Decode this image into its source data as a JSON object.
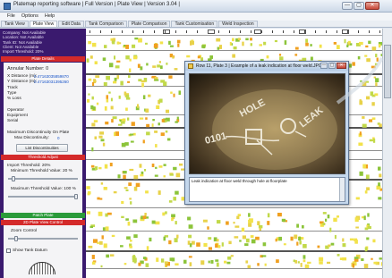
{
  "window": {
    "title": "Platemap reporting software | Full Version | Plate View | Version 3.04 |",
    "controls": [
      "—",
      "▢",
      "✕"
    ]
  },
  "menu": [
    "File",
    "Options",
    "Help"
  ],
  "tabs": [
    "Tank View",
    "Plate View",
    "Edit Data",
    "Tank Comparison",
    "Plate Comparison",
    "Tank Customisation",
    "Weld Inspection"
  ],
  "active_tab": "Plate View",
  "status": [
    "Company: Not Available",
    "Location: Not Available",
    "Tank ID: Not Available",
    "Client: Not Available",
    "Import Threshold: 20%"
  ],
  "plate_details": {
    "header": "Plate Details",
    "annular_number": "Annular Number: 0",
    "x_distance_label": "X Distance (m):",
    "x_distance_value": "0.47163035859870",
    "y_distance_label": "Y Distance (m):",
    "y_distance_value": "0.47163031395260",
    "tracks": "Track",
    "type": "Type",
    "loss": "% Loss",
    "operator": "Operator",
    "equipment": "Equipment",
    "serial": "Serial",
    "max_discontinuity_label": "Maximum Discontinuity On Plate",
    "max_discontinuity_sub": "Max Discontinuity:",
    "max_discontinuity_value": "0",
    "list_button": "List Discontinuities"
  },
  "threshold": {
    "header": "Threshold Adjust",
    "import_threshold": "Import Threshold: 20%",
    "min_label": "Minimum Threshold Value: 20 %",
    "min_value": 0.05,
    "max_label": "Maximum Threshold Value: 100 %",
    "max_value": 1.0
  },
  "patch_plate_button": "Patch Plate",
  "view_control": {
    "header": "2D Plate View Control",
    "zoom_label": "Zoom Control",
    "zoom_value": 0.1,
    "show_tank_datum": "Show Tank Datum"
  },
  "popup": {
    "title": "Row 11, Plate 3 | Example of a leak indication at floor weld.JPG",
    "caption": "Leak indication at floor weld through hole at floorplate",
    "photo_text": [
      "HOLE",
      "LEAK",
      "0101"
    ]
  },
  "colors": {
    "sidebar": "#3a1a6e",
    "red_header": "#d42a2a",
    "green_header": "#2a9b3a",
    "spot_yellow": "#f2e24a",
    "spot_orange": "#f0a020",
    "spot_green": "#8cc43a"
  },
  "icons": {
    "app": "app-icon",
    "popup": "image-icon",
    "close": "close-icon",
    "minimize": "minimize-icon",
    "maximize": "maximize-icon"
  }
}
